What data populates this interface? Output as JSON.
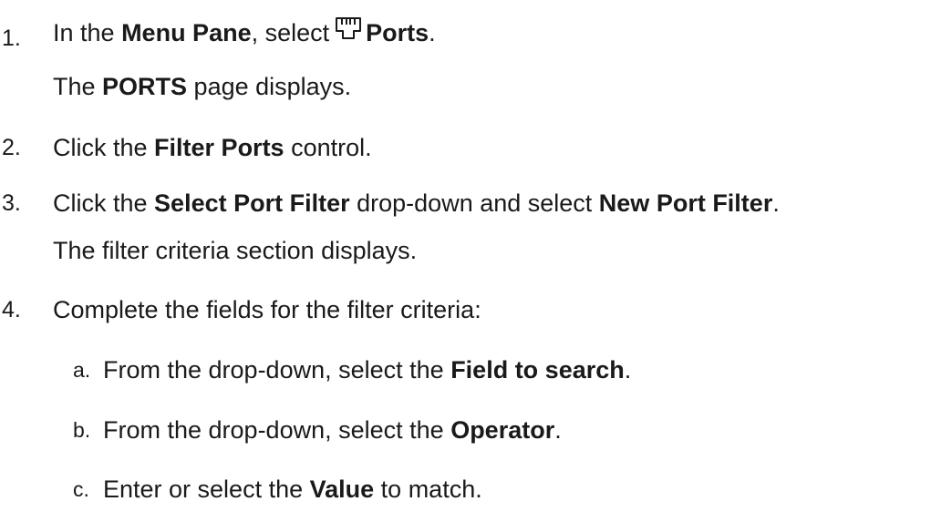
{
  "steps": [
    {
      "number": "1.",
      "parts": {
        "pre": "In the ",
        "b1": "Menu Pane",
        "mid": ", select",
        "icon": "ports-icon",
        "b2": "Ports",
        "post": "."
      },
      "result": {
        "pre": "The ",
        "b1": "PORTS",
        "post": " page displays."
      }
    },
    {
      "number": "2.",
      "parts": {
        "pre": "Click the ",
        "b1": "Filter Ports",
        "post": " control."
      }
    },
    {
      "number": "3.",
      "parts": {
        "pre": "Click the ",
        "b1": "Select Port Filter",
        "mid": " drop-down and select ",
        "b2": "New Port Filter",
        "post": "."
      },
      "result": {
        "text": "The filter criteria section displays."
      }
    },
    {
      "number": "4.",
      "parts": {
        "text": "Complete the fields for the filter criteria:"
      },
      "substeps": [
        {
          "letter": "a.",
          "pre": "From the drop-down, select the ",
          "b1": "Field to search",
          "post": "."
        },
        {
          "letter": "b.",
          "pre": "From the drop-down, select the ",
          "b1": "Operator",
          "post": "."
        },
        {
          "letter": "c.",
          "pre": "Enter or select the ",
          "b1": "Value",
          "post": " to match."
        }
      ]
    }
  ]
}
